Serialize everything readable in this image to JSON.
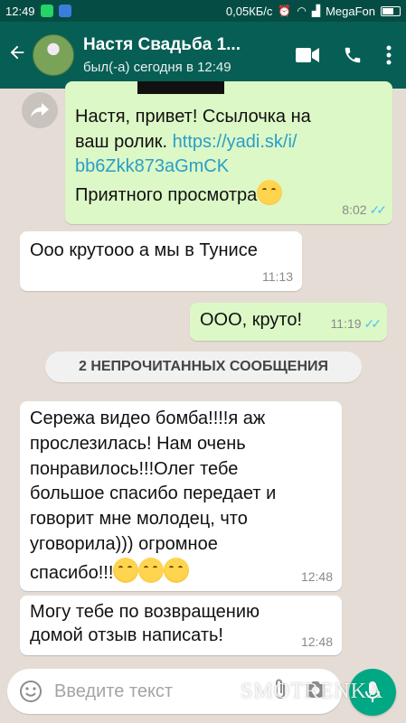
{
  "status_bar": {
    "time": "12:49",
    "network_speed": "0,05КБ/с",
    "carrier": "MegaFon"
  },
  "header": {
    "contact_name": "Настя Свадьба 1...",
    "last_seen": "был(-а) сегодня в 12:49"
  },
  "messages": [
    {
      "direction": "out",
      "lines": [
        "Настя, привет! Ссылочка на",
        "ваш ролик. "
      ],
      "link": "https://yadi.sk/i/bb6Zkk873aGmCK",
      "link_line1": "https://yadi.sk/i/",
      "link_line2": "bb6Zkk873aGmCK",
      "closing": "Приятного просмотра",
      "time": "8:02"
    },
    {
      "direction": "in",
      "text": "Ооо крутооо а мы в Тунисе",
      "time": "11:13"
    },
    {
      "direction": "out",
      "text": "ООО, круто!",
      "time": "11:19"
    },
    {
      "direction": "in",
      "text_lines": [
        "Сережа видео бомба!!!!я аж",
        "прослезилась! Нам очень",
        "понравилось!!!Олег тебе",
        "большое спасибо передает и",
        "говорит мне молодец, что",
        "уговорила))) огромное",
        "спасибо!!!"
      ],
      "time": "12:48"
    },
    {
      "direction": "in",
      "text_lines": [
        "Могу тебе по возвращению",
        "домой отзыв написать!"
      ],
      "time": "12:48"
    }
  ],
  "unread_banner": "2 НЕПРОЧИТАННЫХ СООБЩЕНИЯ",
  "input": {
    "placeholder": "Введите текст"
  },
  "watermark": "SMOTRENKA",
  "colors": {
    "header": "#075e54",
    "status_bar": "#054d44",
    "outgoing_bubble": "#dcf8c6",
    "incoming_bubble": "#ffffff",
    "chat_background": "#e5ddd5",
    "link": "#2a9ec7",
    "read_ticks": "#4fc3f7",
    "mic_button": "#00a884"
  },
  "icons": [
    "back-arrow-icon",
    "video-call-icon",
    "phone-icon",
    "more-menu-icon",
    "forward-icon",
    "emoji-icon",
    "attach-icon",
    "camera-icon",
    "mic-icon"
  ]
}
